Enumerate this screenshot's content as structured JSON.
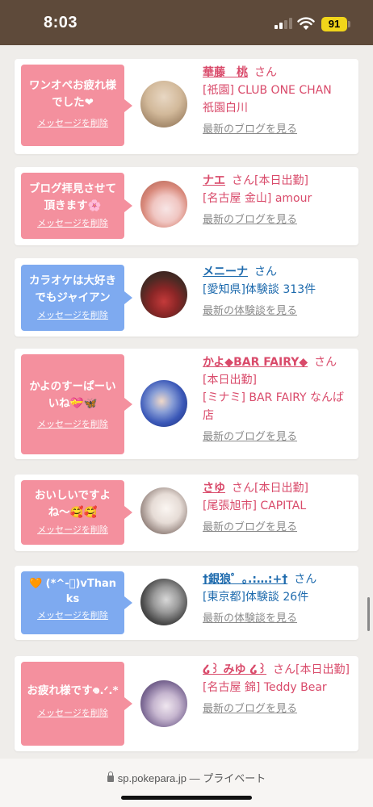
{
  "status_bar": {
    "time": "8:03",
    "battery": "91"
  },
  "cards": [
    {
      "bubble_color": "pink",
      "bubble_text": "ワンオペお疲れ様でした❤",
      "delete_label": "メッセージを削除",
      "name": "華藤　桃",
      "san": "さん",
      "lines": [
        "[祇園] CLUB ONE CHAN",
        "祇園白川"
      ],
      "link": "最新のブログを見る",
      "info_color": "pink",
      "avatar_style": "blonde"
    },
    {
      "bubble_color": "pink",
      "bubble_text": "ブログ拝見させて頂きます🌸",
      "delete_label": "メッセージを削除",
      "name": "ナエ",
      "san": "さん[本日出勤]",
      "lines": [
        "[名古屋 金山] amour"
      ],
      "link": "最新のブログを見る",
      "info_color": "pink",
      "avatar_style": "pink-hair"
    },
    {
      "bubble_color": "blue",
      "bubble_text": "カラオケは大好きでもジャイアン",
      "delete_label": "メッセージを削除",
      "name": "メニーナ",
      "san": "さん",
      "lines": [
        "[愛知県]体験談 313件"
      ],
      "link": "最新の体験談を見る",
      "info_color": "blue",
      "avatar_style": "bar"
    },
    {
      "bubble_color": "pink",
      "bubble_text": "かよのすーぱーいいね💝🦋",
      "delete_label": "メッセージを削除",
      "name": "かよ◆BAR FAIRY◆",
      "san": "さん",
      "lines": [
        "[本日出勤]",
        "[ミナミ] BAR FAIRY なんば店"
      ],
      "link": "最新のブログを見る",
      "info_color": "pink",
      "avatar_style": "blue-light"
    },
    {
      "bubble_color": "pink",
      "bubble_text": "おいしいですよね〜🥰🥰",
      "delete_label": "メッセージを削除",
      "name": "さゆ",
      "san": "さん[本日出勤]",
      "lines": [
        "[尾張旭市] CAPITAL"
      ],
      "link": "最新のブログを見る",
      "info_color": "pink",
      "avatar_style": "light"
    },
    {
      "bubble_color": "blue",
      "bubble_text": "🧡 (*^-ﾟ)vThanks",
      "delete_label": "メッセージを削除",
      "name": "†銀狼゜｡.:…:+†",
      "san": "さん",
      "lines": [
        "[東京都]体験談 26件"
      ],
      "link": "最新の体験談を見る",
      "info_color": "blue",
      "avatar_style": "mono"
    },
    {
      "bubble_color": "pink",
      "bubble_text": "お疲れ様です𖦹.ᐟ.*",
      "delete_label": "メッセージを削除",
      "name": "໒꒱ みゆ ໒꒱",
      "san": "さん[本日出勤]",
      "lines": [
        "[名古屋 錦] Teddy Bear"
      ],
      "link": "最新のブログを見る",
      "info_color": "pink",
      "avatar_style": "purple"
    }
  ],
  "bottom_bar": {
    "url": "sp.pokepara.jp",
    "separator": " — ",
    "privacy": "プライベート"
  }
}
